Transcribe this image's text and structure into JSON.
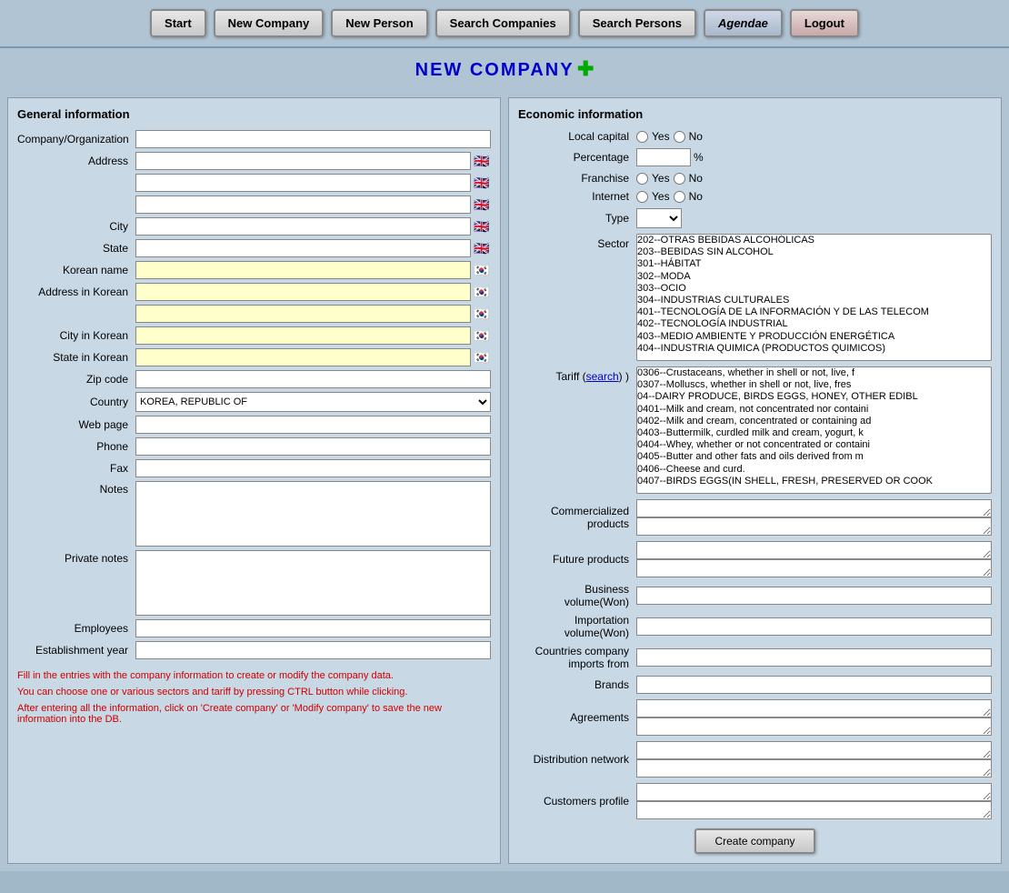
{
  "nav": {
    "start_label": "Start",
    "new_company_label": "New Company",
    "new_person_label": "New Person",
    "search_companies_label": "Search Companies",
    "search_persons_label": "Search Persons",
    "agendae_label": "Agendae",
    "logout_label": "Logout"
  },
  "page_title": "NEW COMPANY",
  "plus_symbol": "✚",
  "general": {
    "title": "General information",
    "company_label": "Company/Organization",
    "address_label": "Address",
    "city_label": "City",
    "state_label": "State",
    "korean_name_label": "Korean name",
    "address_korean_label": "Address in Korean",
    "city_korean_label": "City in Korean",
    "state_korean_label": "State in Korean",
    "zip_label": "Zip code",
    "country_label": "Country",
    "country_value": "KOREA, REPUBLIC OF",
    "webpage_label": "Web page",
    "phone_label": "Phone",
    "fax_label": "Fax",
    "notes_label": "Notes",
    "private_notes_label": "Private notes",
    "employees_label": "Employees",
    "establishment_label": "Establishment year"
  },
  "economic": {
    "title": "Economic information",
    "local_capital_label": "Local capital",
    "yes_label": "Yes",
    "no_label": "No",
    "percentage_label": "Percentage",
    "pct_symbol": "%",
    "franchise_label": "Franchise",
    "internet_label": "Internet",
    "type_label": "Type",
    "sector_label": "Sector",
    "sector_items": [
      "202--OTRAS BEBIDAS ALCOHÓLICAS",
      "203--BEBIDAS SIN ALCOHOL",
      "301--HÁBITAT",
      "302--MODA",
      "303--OCIO",
      "304--INDUSTRIAS CULTURALES",
      "401--TECNOLOGÍA DE LA INFORMACIÓN Y DE LAS TELECOM",
      "402--TECNOLOGÍA INDUSTRIAL",
      "403--MEDIO AMBIENTE Y PRODUCCIÓN ENERGÉTICA",
      "404--INDUSTRIA QUIMICA (PRODUCTOS QUIMICOS)"
    ],
    "tariff_label": "Tariff",
    "tariff_search_label": "search",
    "tariff_items": [
      "0306--Crustaceans, whether in shell or not, live, f",
      "0307--Molluscs, whether in shell or not, live, fres",
      "04--DAIRY PRODUCE, BIRDS EGGS, HONEY, OTHER EDIBL",
      "0401--Milk and cream, not concentrated nor containi",
      "0402--Milk and cream, concentrated or containing ad",
      "0403--Buttermilk, curdled milk and cream, yogurt, k",
      "0404--Whey, whether or not concentrated or containi",
      "0405--Butter and other fats and oils derived from m",
      "0406--Cheese and curd.",
      "0407--BIRDS EGGS(IN SHELL, FRESH, PRESERVED OR COOK"
    ],
    "commercialized_label": "Commercialized products",
    "future_label": "Future products",
    "business_volume_label": "Business volume(Won)",
    "importation_volume_label": "Importation volume(Won)",
    "countries_imports_label": "Countries company imports from",
    "brands_label": "Brands",
    "agreements_label": "Agreements",
    "distribution_label": "Distribution network",
    "customers_label": "Customers profile"
  },
  "instructions": [
    "Fill in the entries with the company information to create or modify the company data.",
    "You can choose one or various sectors and tariff by pressing CTRL button while clicking.",
    "After entering all the information, click on 'Create company' or 'Modify company' to save the new information into the DB."
  ],
  "create_btn_label": "Create company"
}
